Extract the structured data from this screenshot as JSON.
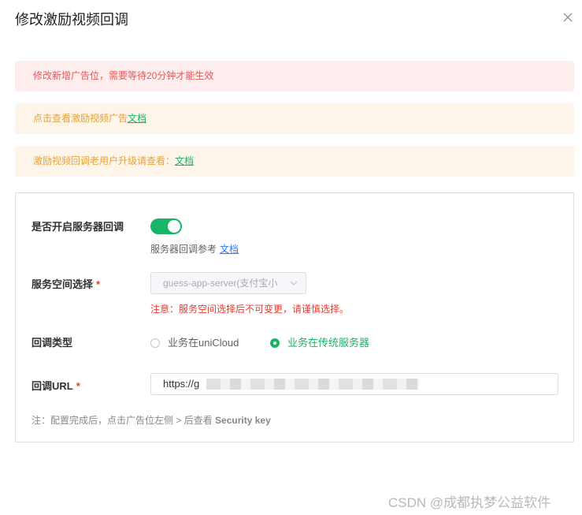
{
  "dialog": {
    "title": "修改激励视频回调"
  },
  "alerts": {
    "red": "修改新增广告位，需要等待20分钟才能生效",
    "orange1_text": "点击查看激励视频广告",
    "orange1_link": "文档",
    "orange2_text": "激励视频回调老用户升级请查看：",
    "orange2_link": "文档"
  },
  "form": {
    "server_callback_label": "是否开启服务器回调",
    "server_callback_enabled": true,
    "server_callback_hint": "服务器回调参考",
    "server_callback_hint_link": "文档",
    "space_label": "服务空间选择",
    "required_mark": "*",
    "space_value": "guess-app-server(支付宝小",
    "space_warning": "注意：服务空间选择后不可变更，请谨慎选择。",
    "callback_type_label": "回调类型",
    "radio_option1": "业务在uniCloud",
    "radio_option2": "业务在传统服务器",
    "selected_option": "业务在传统服务器",
    "url_label": "回调URL",
    "url_value": "https://g",
    "footer_note_prefix": "注：配置完成后，点击广告位左侧 > 后查看",
    "footer_note_key": "Security key"
  },
  "watermark": "CSDN @成都执梦公益软件",
  "colors": {
    "accent": "#18b566",
    "error": "#e43d33",
    "warning_bg": "#fdf5ea",
    "danger_bg": "#fdeded"
  },
  "icons": {
    "close": "close-icon",
    "select_arrow": "chevron-down-icon"
  }
}
